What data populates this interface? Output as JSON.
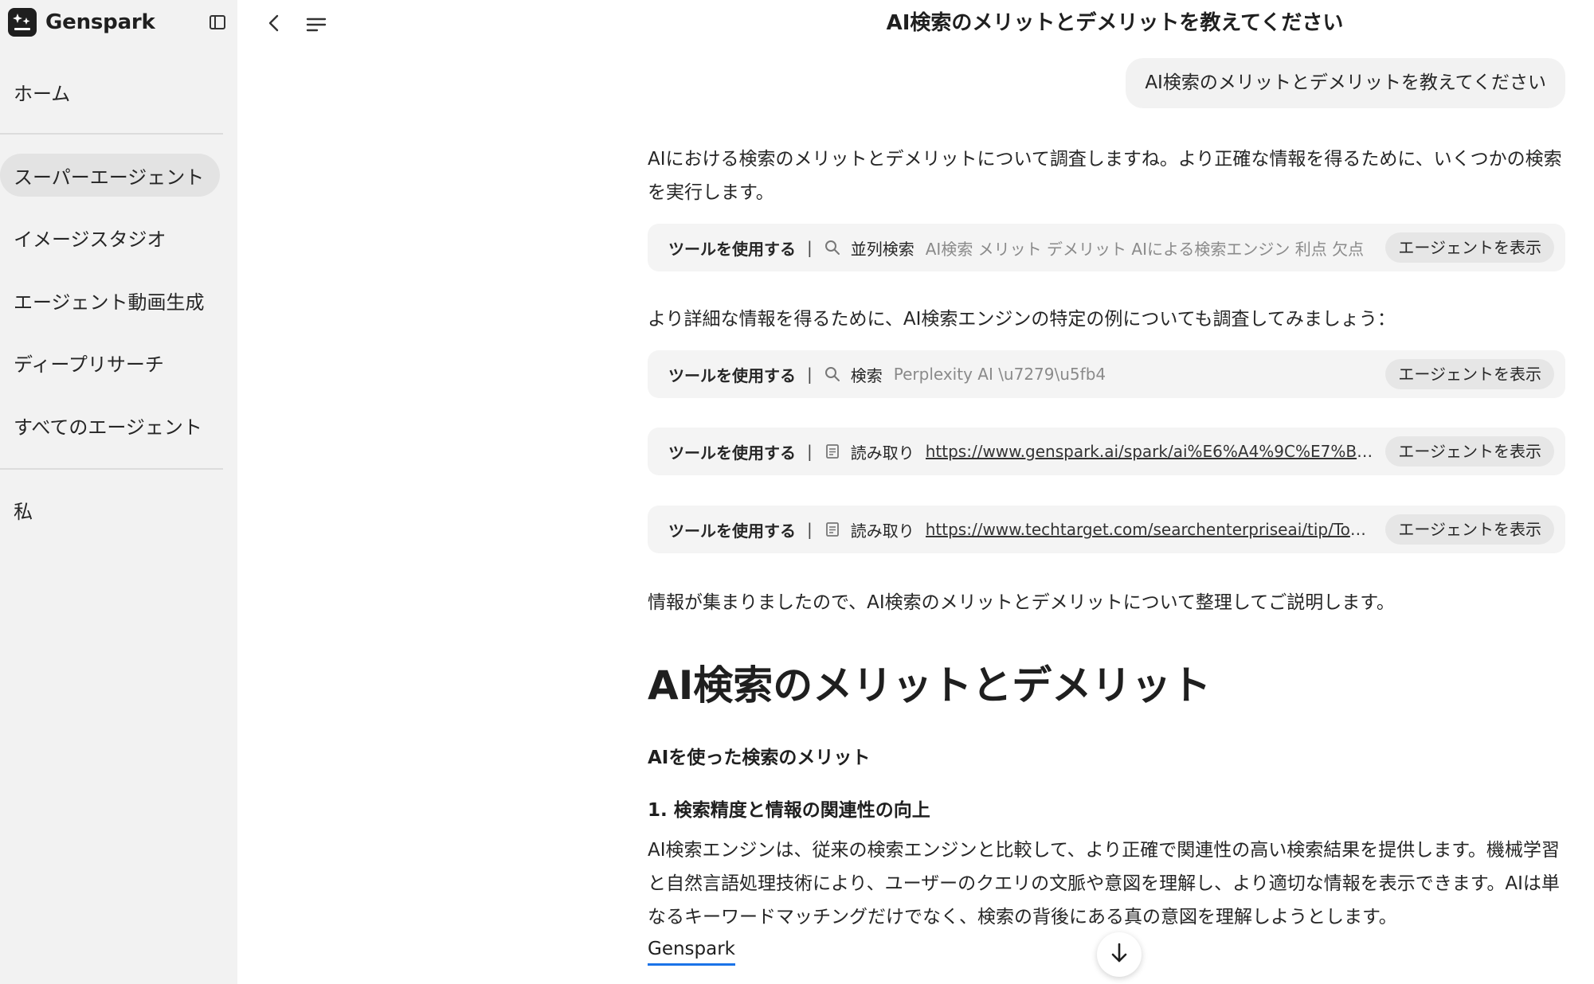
{
  "brand": {
    "name": "Genspark"
  },
  "sidebar": {
    "items": [
      {
        "label": "ホーム"
      },
      {
        "label": "スーパーエージェント"
      },
      {
        "label": "イメージスタジオ"
      },
      {
        "label": "エージェント動画生成"
      },
      {
        "label": "ディープリサーチ"
      },
      {
        "label": "すべてのエージェント"
      },
      {
        "label": "私"
      }
    ]
  },
  "header": {
    "title": "AI検索のメリットとデメリットを教えてください"
  },
  "chat": {
    "user_message": "AI検索のメリットとデメリットを教えてください",
    "intro": "AIにおける検索のメリットとデメリットについて調査しますね。より正確な情報を得るために、いくつかの検索を実行します。",
    "followup": "より詳細な情報を得るために、AI検索エンジンの特定の例についても調査してみましょう：",
    "gathered": "情報が集まりましたので、AI検索のメリットとデメリットについて整理してご説明します。",
    "tools": [
      {
        "label": "ツールを使用する",
        "sep": "|",
        "name": "並列検索",
        "query": "AI検索 メリット デメリット AIによる検索エンジン 利点 欠点",
        "button": "エージェントを表示",
        "icon": "search-icon"
      },
      {
        "label": "ツールを使用する",
        "sep": "|",
        "name": "検索",
        "query": "Perplexity AI \\u7279\\u5fb4",
        "button": "エージェントを表示",
        "icon": "search-icon"
      },
      {
        "label": "ツールを使用する",
        "sep": "|",
        "name": "読み取り",
        "link": "https://www.genspark.ai/spark/ai%E6%A4%9C%E7%B4%A2",
        "button": "エージェントを表示",
        "icon": "document-icon"
      },
      {
        "label": "ツールを使用する",
        "sep": "|",
        "name": "読み取り",
        "link": "https://www.techtarget.com/searchenterpriseai/tip/Top-advantages-and-disadvantages-of-AI",
        "button": "エージェントを表示",
        "icon": "document-icon"
      }
    ],
    "heading": "AI検索のメリットとデメリット",
    "subheading": "AIを使った検索のメリット",
    "item1_title": "1. 検索精度と情報の関連性の向上",
    "item1_body": "AI検索エンジンは、従来の検索エンジンと比較して、より正確で関連性の高い検索結果を提供します。機械学習と自然言語処理技術により、ユーザーのクエリの文脈や意図を理解し、より適切な情報を表示できます。AIは単なるキーワードマッチングだけでなく、検索の背後にある真の意図を理解しようとします。",
    "citation": "Genspark"
  },
  "colors": {
    "link_underline": "#1a73e8",
    "sidebar_bg": "#f2f2f2",
    "tool_bg": "#f4f4f4"
  }
}
